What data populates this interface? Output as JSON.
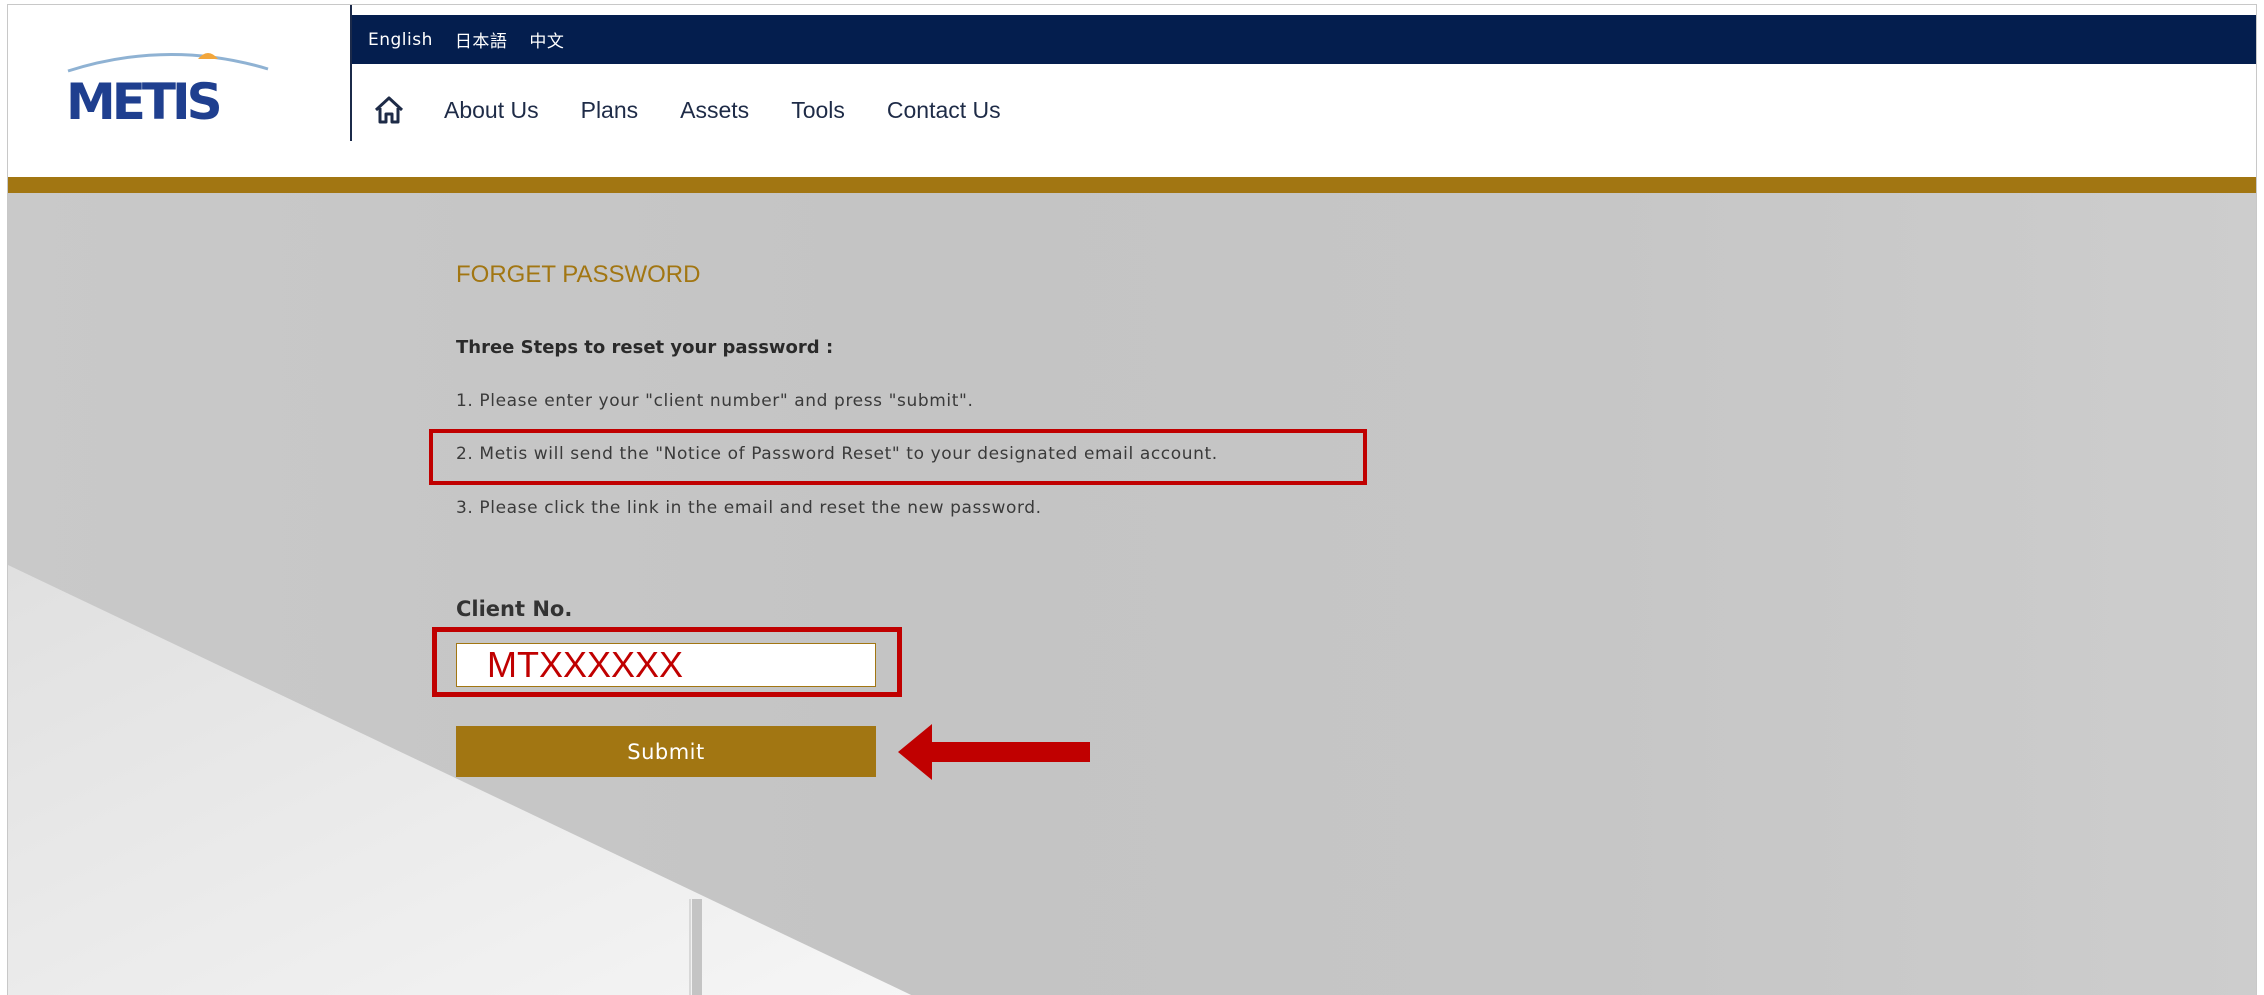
{
  "header": {
    "logo_text": "METIS",
    "languages": [
      "English",
      "日本語",
      "中文"
    ],
    "nav": [
      "About Us",
      "Plans",
      "Assets",
      "Tools",
      "Contact Us"
    ]
  },
  "page": {
    "title": "FORGET PASSWORD",
    "steps_heading": "Three Steps to reset your password :",
    "steps": [
      "1. Please enter your \"client number\" and press \"submit\".",
      "2. Metis will send the \"Notice of Password Reset\" to your designated email account.",
      "3. Please click the link in the email and reset the new password."
    ],
    "client_label": "Client No.",
    "client_value": "MTXXXXXX",
    "submit_label": "Submit"
  },
  "colors": {
    "navy": "#041e4e",
    "gold": "#a27612",
    "highlight_red": "#c00000"
  }
}
